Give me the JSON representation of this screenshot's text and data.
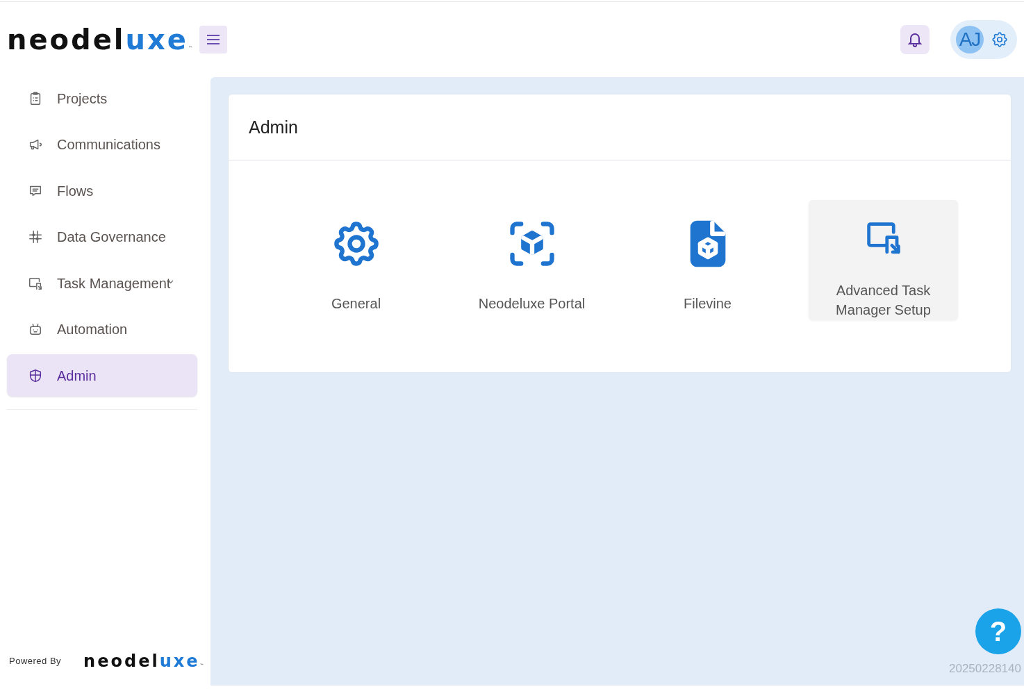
{
  "logo": {
    "plain": "neodel",
    "accent": "uxe",
    "mark": "™"
  },
  "header": {
    "notifications": {
      "selected": true
    },
    "avatar": {
      "initials": "AJ"
    }
  },
  "sidebar": {
    "items": [
      {
        "label": "Projects",
        "selected": false,
        "has_submenu": false
      },
      {
        "label": "Communications",
        "selected": false,
        "has_submenu": false
      },
      {
        "label": "Flows",
        "selected": false,
        "has_submenu": false
      },
      {
        "label": "Data Governance",
        "selected": false,
        "has_submenu": false
      },
      {
        "label": "Task Management",
        "selected": false,
        "has_submenu": true
      },
      {
        "label": "Automation",
        "selected": false,
        "has_submenu": false
      },
      {
        "label": "Admin",
        "selected": true,
        "has_submenu": false
      }
    ]
  },
  "footer": {
    "powered_by": "Powered By",
    "logo": {
      "plain": "neodel",
      "accent": "uxe",
      "mark": "™"
    }
  },
  "page": {
    "title": "Admin",
    "tiles": [
      {
        "label": "General",
        "hovered": false
      },
      {
        "label": "Neodeluxe Portal",
        "hovered": false
      },
      {
        "label": "Filevine",
        "hovered": false
      },
      {
        "label": "Advanced Task Manager Setup",
        "hovered": true
      }
    ]
  },
  "help_button": {
    "label": "?"
  },
  "build_id": "20250228140"
}
